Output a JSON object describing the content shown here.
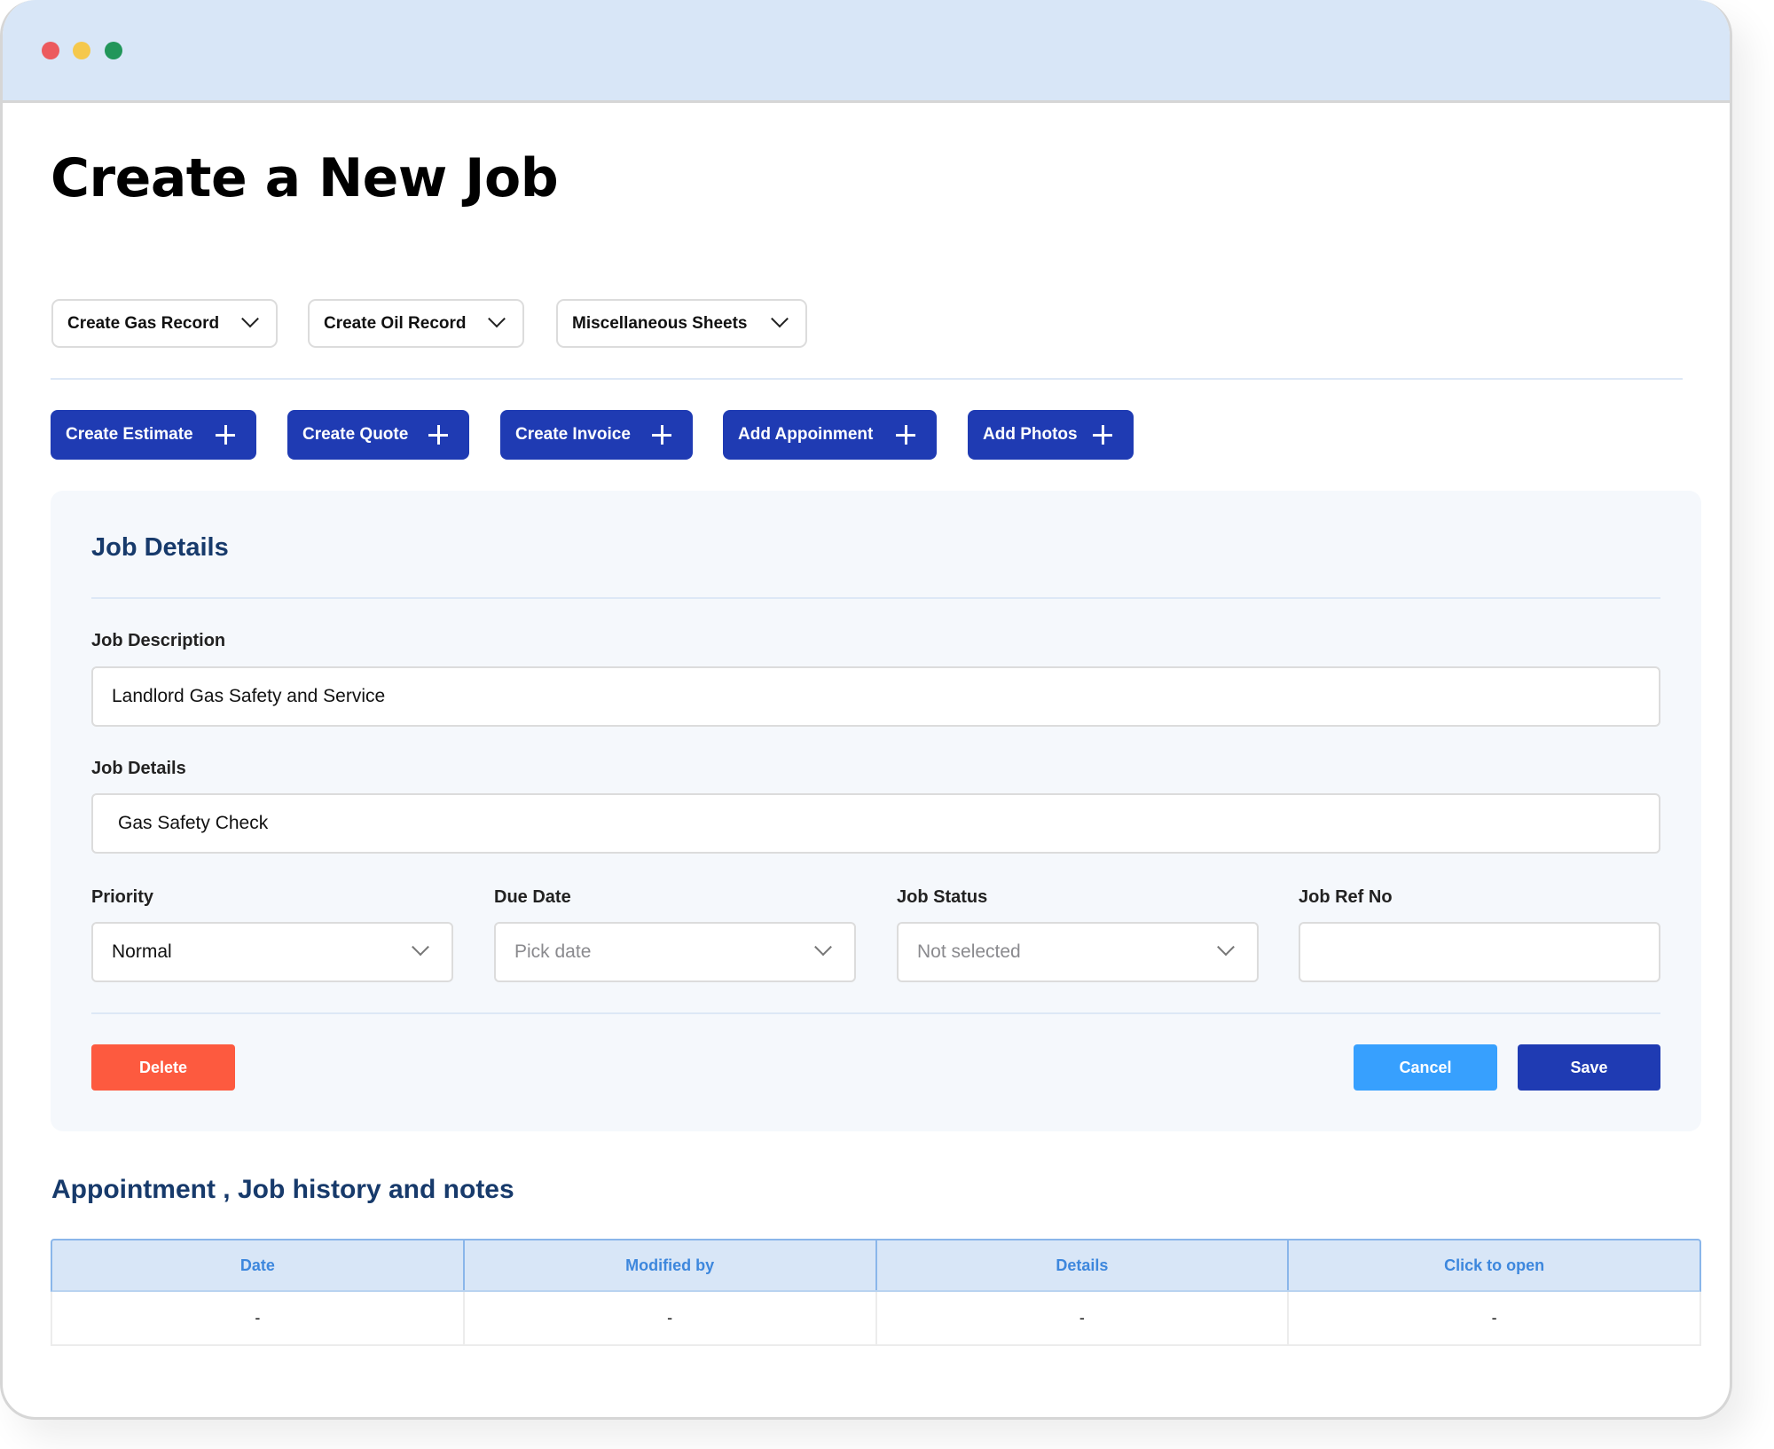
{
  "window": {
    "controls": [
      "close",
      "minimize",
      "maximize"
    ]
  },
  "page": {
    "title": "Create a New Job"
  },
  "dropdowns": [
    {
      "label": "Create Gas Record",
      "icon": "chevron-down-icon"
    },
    {
      "label": "Create Oil Record",
      "icon": "chevron-down-icon"
    },
    {
      "label": "Miscellaneous Sheets",
      "icon": "chevron-down-icon"
    }
  ],
  "actions": [
    {
      "label": "Create Estimate",
      "icon": "plus-icon"
    },
    {
      "label": "Create Quote",
      "icon": "plus-icon"
    },
    {
      "label": "Create Invoice",
      "icon": "plus-icon"
    },
    {
      "label": "Add Appoinment",
      "icon": "plus-icon"
    },
    {
      "label": "Add Photos",
      "icon": "plus-icon"
    }
  ],
  "job_details": {
    "heading": "Job Details",
    "description": {
      "label": "Job Description",
      "value": "Landlord Gas Safety and Service"
    },
    "details": {
      "label": "Job Details",
      "value": "Gas Safety Check"
    },
    "priority": {
      "label": "Priority",
      "value": "Normal"
    },
    "due_date": {
      "label": "Due Date",
      "placeholder": "Pick date"
    },
    "job_status": {
      "label": "Job Status",
      "placeholder": "Not selected"
    },
    "job_ref_no": {
      "label": "Job Ref No",
      "value": ""
    },
    "buttons": {
      "delete": "Delete",
      "cancel": "Cancel",
      "save": "Save"
    }
  },
  "history": {
    "heading": "Appointment , Job history and notes",
    "columns": [
      "Date",
      "Modified by",
      "Details",
      "Click to open"
    ],
    "rows": [
      [
        "-",
        "-",
        "-",
        "-"
      ]
    ]
  },
  "colors": {
    "primary": "#1f3bb3",
    "danger": "#fd5a3f",
    "secondary": "#37a0fe",
    "heading": "#173a6b",
    "table_header_bg": "#d8e6f7",
    "table_header_text": "#3d87dd"
  }
}
